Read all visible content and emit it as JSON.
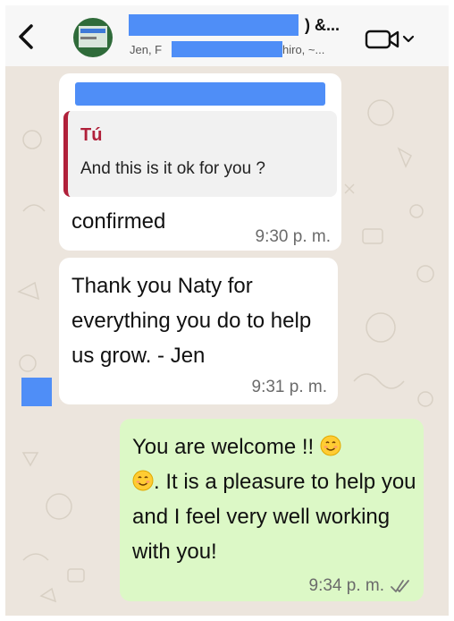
{
  "header": {
    "title_suffix": ") &...",
    "subtitle_start": "Jen, F",
    "subtitle_end": "hiro, ~..."
  },
  "messages": [
    {
      "quote_author": "Tú",
      "quote_text": "And this is it ok for you ?",
      "text": "confirmed",
      "time": "9:30 p. m."
    },
    {
      "text": "Thank you Naty for everything you do to help us grow.  - Jen",
      "time": "9:31 p. m."
    },
    {
      "text_part1": "You are welcome !! ",
      "text_part2": ". It is a pleasure to help you and I feel very well working with you!",
      "time": "9:34 p. m.",
      "status": "read"
    }
  ],
  "colors": {
    "chat_background": "#ece5dd",
    "outgoing_bubble": "#dcf8c6",
    "incoming_bubble": "#ffffff",
    "quote_accent": "#b0203a",
    "redaction": "#4f8ef7"
  },
  "icons": [
    "back-chevron-icon",
    "video-call-icon",
    "chevron-down-icon",
    "smiling-face-emoji",
    "double-check-icon"
  ]
}
